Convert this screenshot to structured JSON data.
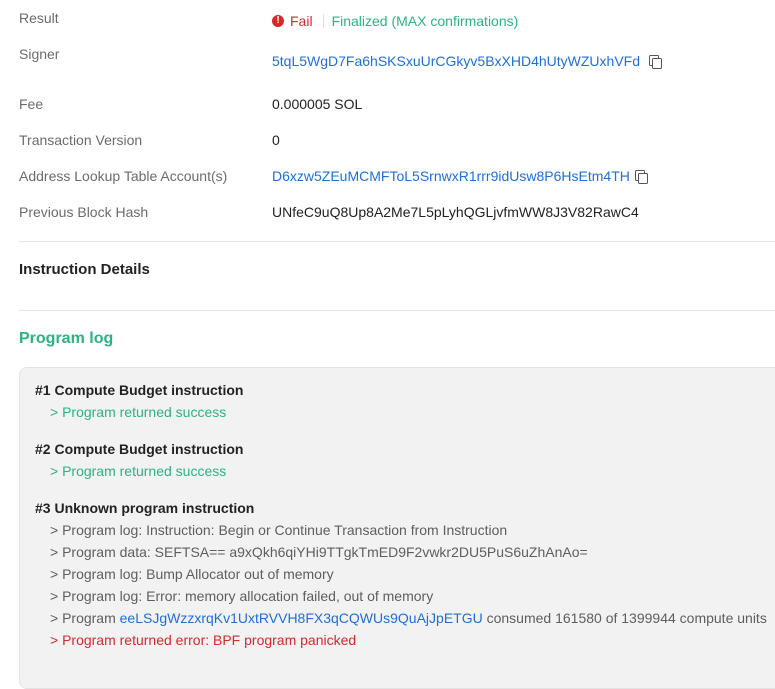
{
  "details": {
    "result": {
      "label": "Result",
      "status": "Fail",
      "finality": "Finalized (MAX confirmations)"
    },
    "signer": {
      "label": "Signer",
      "value": "5tqL5WgD7Fa6hSKSxuUrCGkyv5BxXHD4hUtyWZUxhVFd"
    },
    "fee": {
      "label": "Fee",
      "value": "0.000005 SOL"
    },
    "version": {
      "label": "Transaction Version",
      "value": "0"
    },
    "lookup": {
      "label": "Address Lookup Table Account(s)",
      "value": "D6xzw5ZEuMCMFToL5SrnwxR1rrr9idUsw8P6HsEtm4TH"
    },
    "blockhash": {
      "label": "Previous Block Hash",
      "value": "UNfeC9uQ8Up8A2Me7L5pLyhQGLjvfmWW8J3V82RawC4"
    }
  },
  "instruction_details": {
    "title": "Instruction Details"
  },
  "program_log": {
    "title": "Program log",
    "instructions": [
      {
        "title": "#1 Compute Budget instruction",
        "lines": [
          "> Program returned success"
        ]
      },
      {
        "title": "#2 Compute Budget instruction",
        "lines": [
          "> Program returned success"
        ]
      },
      {
        "title": "#3 Unknown program instruction",
        "lines": [
          "> Program log: Instruction: Begin or Continue Transaction from Instruction",
          "> Program data: SEFTSA== a9xQkh6qiYHi9TTgkTmED9F2vwkr2DU5PuS6uZhAnAo=",
          "> Program log: Bump Allocator out of memory",
          "> Program log: Error: memory allocation failed, out of memory"
        ],
        "consumed": {
          "prefix": "> Program",
          "program": "eeLSJgWzzxrqKv1UxtRVVH8FX3qCQWUs9QuAjJpETGU",
          "suffix": "consumed 161580 of 1399944 compute units"
        },
        "error": "> Program returned error: BPF program panicked"
      }
    ]
  },
  "colors": {
    "success": "#2bb380",
    "error": "#d42a2a",
    "link": "#1e6fd9"
  },
  "icons": {
    "fail": "error-circle-icon",
    "copy": "copy-icon"
  }
}
